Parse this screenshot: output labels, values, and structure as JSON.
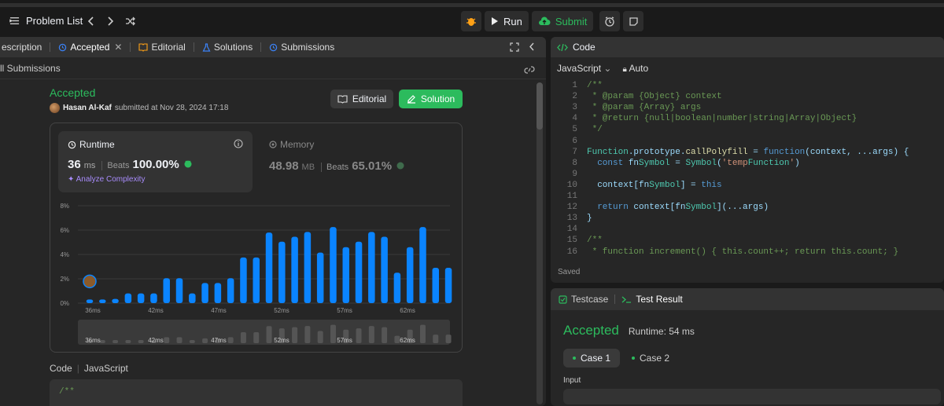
{
  "topnav": {
    "problem_list": "Problem List",
    "run": "Run",
    "submit": "Submit"
  },
  "left_tabs": [
    {
      "label": "escription",
      "icon": "description-icon"
    },
    {
      "label": "Accepted",
      "icon": "history-icon"
    },
    {
      "label": "Editorial",
      "icon": "book-icon"
    },
    {
      "label": "Solutions",
      "icon": "flask-icon"
    },
    {
      "label": "Submissions",
      "icon": "history-icon"
    }
  ],
  "all_submissions": "ll Submissions",
  "result": {
    "status": "Accepted",
    "user": "Hasan Al-Kaf",
    "submitted_text": "submitted at Nov 28, 2024 17:18",
    "editorial_btn": "Editorial",
    "solution_btn": "Solution"
  },
  "runtime": {
    "label": "Runtime",
    "value": "36",
    "unit": "ms",
    "beats_label": "Beats",
    "beats": "100.00%",
    "analyze": "Analyze Complexity"
  },
  "memory": {
    "label": "Memory",
    "value": "48.98",
    "unit": "MB",
    "beats_label": "Beats",
    "beats": "65.01%"
  },
  "chart_data": {
    "type": "bar",
    "title": "",
    "ylabel": "",
    "xlabel": "",
    "ylim": [
      0,
      8
    ],
    "y_ticks": [
      "8%",
      "6%",
      "4%",
      "2%",
      "0%"
    ],
    "x_tick_labels": [
      "36ms",
      "42ms",
      "47ms",
      "52ms",
      "57ms",
      "62ms"
    ],
    "values": [
      0.3,
      0.3,
      0.35,
      0.8,
      0.8,
      0.8,
      2.05,
      2.05,
      0.8,
      1.65,
      1.65,
      2.05,
      3.75,
      3.75,
      5.8,
      5.05,
      5.45,
      5.85,
      4.15,
      6.25,
      4.6,
      5.05,
      5.85,
      5.45,
      2.5,
      4.6,
      6.25,
      2.9,
      2.9
    ],
    "highlight_index": 0,
    "grid": true,
    "legend": "none"
  },
  "code_section": {
    "label": "Code",
    "lang": "JavaScript",
    "preview": "/**"
  },
  "editor": {
    "header": "Code",
    "language": "JavaScript",
    "mode": "Auto",
    "lines": [
      "/**",
      " * @param {Object} context",
      " * @param {Array} args",
      " * @return {null|boolean|number|string|Array|Object}",
      " */",
      "",
      "Function.prototype.callPolyfill = function(context, ...args) {",
      "  const fnSymbol = Symbol('tempFunction')",
      "",
      "  context[fnSymbol] = this",
      "",
      "  return context[fnSymbol](...args)",
      "}",
      "",
      "/**",
      " * function increment() { this.count++; return this.count; }"
    ],
    "saved": "Saved"
  },
  "bottom": {
    "tab_testcase": "Testcase",
    "tab_result": "Test Result",
    "status": "Accepted",
    "runtime": "Runtime: 54 ms",
    "case1": "Case 1",
    "case2": "Case 2",
    "input_label": "Input"
  },
  "colors": {
    "accent_green": "#2cbb5d",
    "bar_blue": "#0a84ff",
    "bg": "#1a1a1a",
    "panel": "#262626"
  }
}
